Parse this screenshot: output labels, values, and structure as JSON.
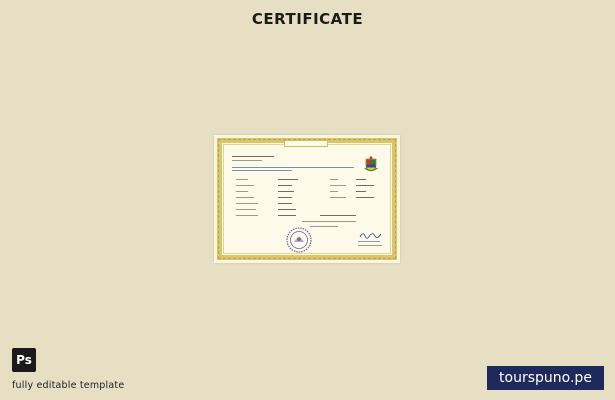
{
  "header": {
    "title": "CERTIFICATE"
  },
  "badge": {
    "app_label": "Ps",
    "caption": "fully editable template"
  },
  "watermark": {
    "brand": "tourspuno.pe"
  },
  "colors": {
    "background": "#e6dfc3",
    "certificate_border": "#d9c56a",
    "brand_box": "#1f2a5c"
  },
  "icons": {
    "certificate_emblem": "coat-of-arms-icon",
    "certificate_seal": "stamp-seal-icon",
    "certificate_signature": "signature-icon"
  }
}
